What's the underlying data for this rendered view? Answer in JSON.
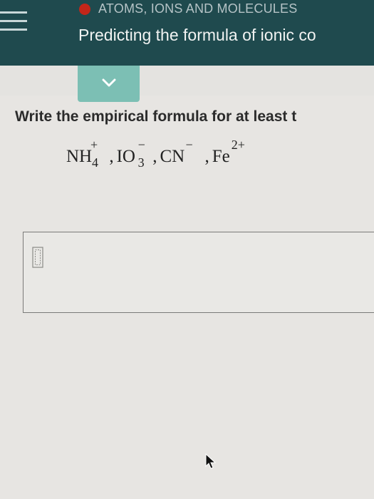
{
  "header": {
    "topic": "ATOMS, IONS AND MOLECULES",
    "title": "Predicting the formula of ionic co"
  },
  "question": {
    "prompt": "Write the empirical formula for at least t",
    "ions": [
      {
        "base": "NH",
        "sub": "4",
        "sup": "+"
      },
      {
        "base": "IO",
        "sub": "3",
        "sup": "−"
      },
      {
        "base": "CN",
        "sub": "",
        "sup": "−"
      },
      {
        "base": "Fe",
        "sub": "",
        "sup": "2+"
      }
    ],
    "separator": ","
  },
  "answer": {
    "value": ""
  },
  "colors": {
    "header_bg": "#1f4a4e",
    "topic_dot": "#c2261a",
    "accent_tab": "#7cbfb4",
    "page_bg": "#e7e5e2"
  },
  "icons": [
    "menu-icon",
    "chevron-down-icon",
    "template-box-icon",
    "mouse-pointer-icon"
  ]
}
